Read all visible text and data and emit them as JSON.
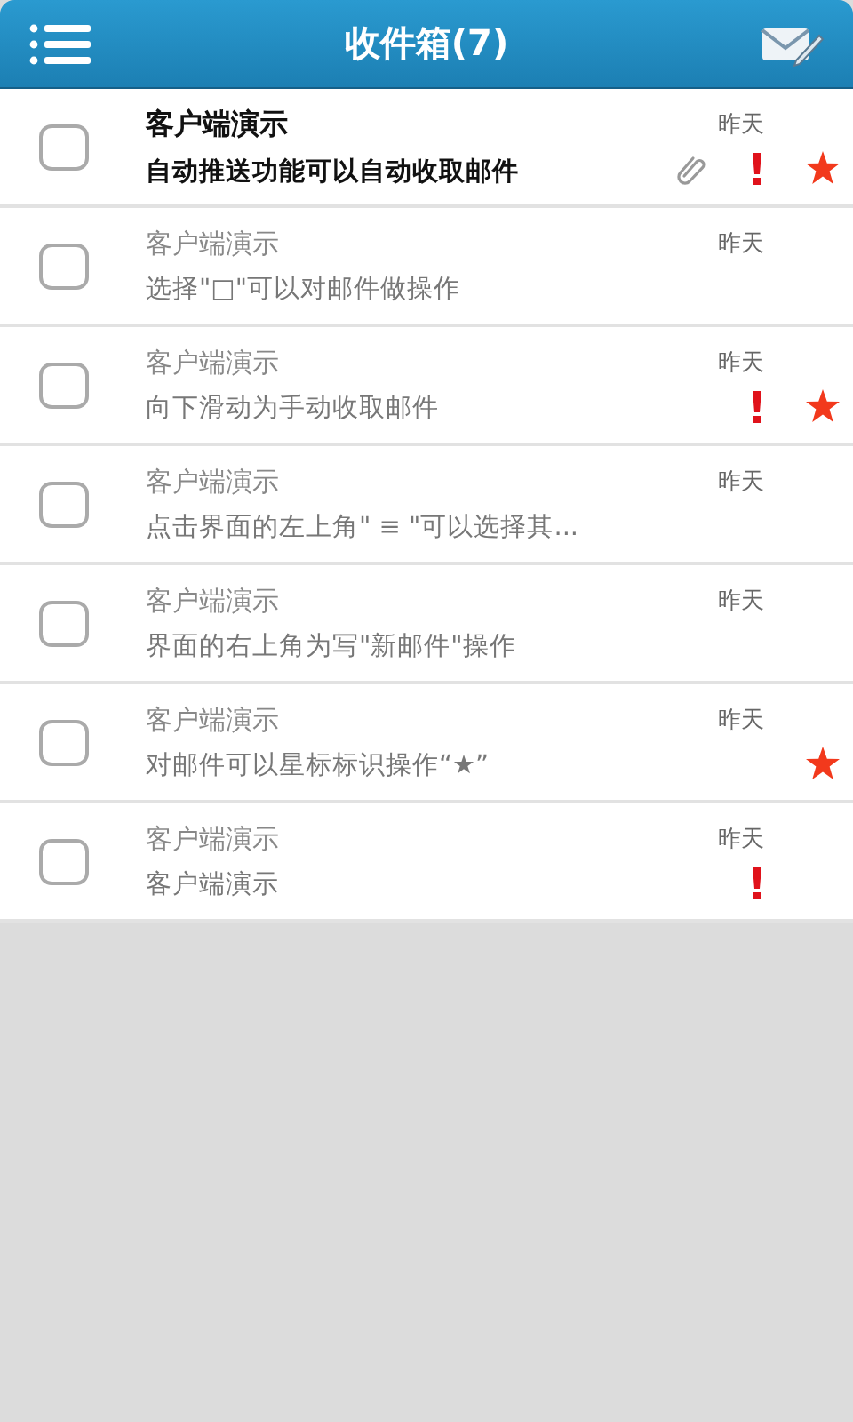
{
  "header": {
    "title": "收件箱(7)"
  },
  "messages": [
    {
      "sender": "客户端演示",
      "subject": "自动推送功能可以自动收取邮件",
      "date": "昨天",
      "unread": true,
      "checked": false,
      "attachment": true,
      "important": true,
      "starred": true
    },
    {
      "sender": "客户端演示",
      "subject": "选择\"□\"可以对邮件做操作",
      "date": "昨天",
      "unread": false,
      "checked": false,
      "attachment": false,
      "important": false,
      "starred": false
    },
    {
      "sender": "客户端演示",
      "subject": "向下滑动为手动收取邮件",
      "date": "昨天",
      "unread": false,
      "checked": false,
      "attachment": false,
      "important": true,
      "starred": true
    },
    {
      "sender": "客户端演示",
      "subject": "点击界面的左上角\" ≡ \"可以选择其...",
      "date": "昨天",
      "unread": false,
      "checked": false,
      "attachment": false,
      "important": false,
      "starred": false
    },
    {
      "sender": "客户端演示",
      "subject": "界面的右上角为写\"新邮件\"操作",
      "date": "昨天",
      "unread": false,
      "checked": false,
      "attachment": false,
      "important": false,
      "starred": false
    },
    {
      "sender": "客户端演示",
      "subject": "对邮件可以星标标识操作“★”",
      "date": "昨天",
      "unread": false,
      "checked": false,
      "attachment": false,
      "important": false,
      "starred": true
    },
    {
      "sender": "客户端演示",
      "subject": "客户端演示",
      "date": "昨天",
      "unread": false,
      "checked": false,
      "attachment": false,
      "important": true,
      "starred": false
    }
  ]
}
